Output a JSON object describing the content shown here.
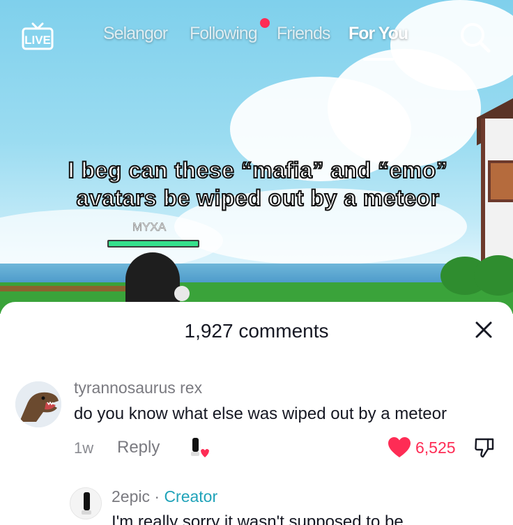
{
  "top_nav": {
    "live_label": "LIVE",
    "tabs": [
      {
        "label": "Selangor",
        "active": false
      },
      {
        "label": "Following",
        "active": false,
        "has_notification_dot": true
      },
      {
        "label": "Friends",
        "active": false
      },
      {
        "label": "For You",
        "active": true
      }
    ]
  },
  "video": {
    "caption": "I beg can these “mafia” and “emo” avatars be wiped out by a meteor",
    "player_name": "MYXA",
    "player_health": 1.0
  },
  "comments_panel": {
    "title": "1,927 comments",
    "comments": [
      {
        "username": "tyrannosaurus rex",
        "text": "do you know what else was wiped out by a meteor",
        "age": "1w",
        "reply_label": "Reply",
        "like_count": "6,525",
        "liked": true
      }
    ],
    "reply": {
      "username": "2epic",
      "separator": "·",
      "badge": "Creator",
      "text": "I'm really sorry it wasn't supposed to be"
    }
  },
  "colors": {
    "accent_red": "#fe2c55",
    "creator_teal": "#20a3b9",
    "text_primary": "#161823",
    "text_secondary": "#7a7a80"
  }
}
